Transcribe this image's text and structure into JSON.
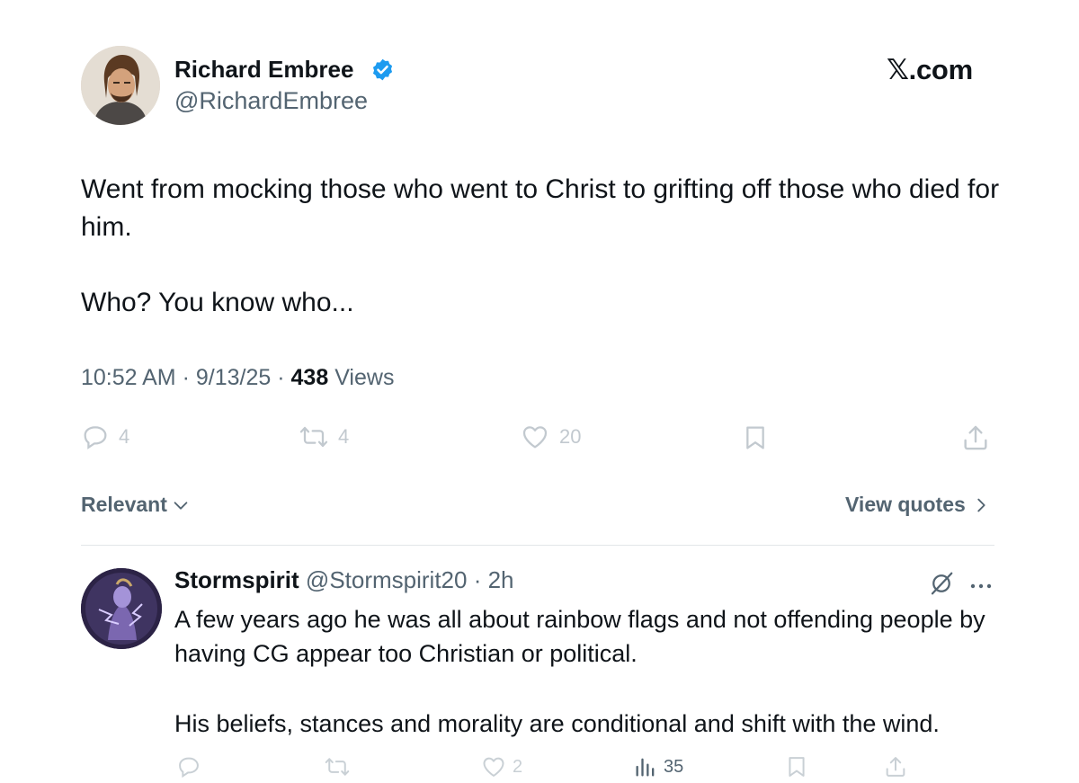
{
  "header": {
    "author_name": "Richard Embree",
    "author_handle": "@RichardEmbree",
    "brand": "𝕏.com"
  },
  "tweet": {
    "paragraphs": [
      "Went from mocking those who went to Christ to grifting off those who died for him.",
      "Who? You know who..."
    ],
    "time": "10:52 AM",
    "date": "9/13/25",
    "views_count": "438",
    "views_label": "Views",
    "actions": {
      "replies": "4",
      "reposts": "4",
      "likes": "20"
    }
  },
  "sort": {
    "label": "Relevant",
    "view_quotes": "View quotes"
  },
  "reply": {
    "name": "Stormspirit",
    "handle": "@Stormspirit20",
    "age": "2h",
    "paragraphs": [
      "A few years ago he was all about rainbow flags and not offending people by having CG appear too Christian or political.",
      "His beliefs, stances and morality are conditional and shift with the wind."
    ],
    "actions": {
      "likes": "2",
      "views": "35"
    }
  },
  "colors": {
    "verified": "#1d9bf0",
    "muted_text": "#536471",
    "faded_icon": "#c2c9cf"
  }
}
